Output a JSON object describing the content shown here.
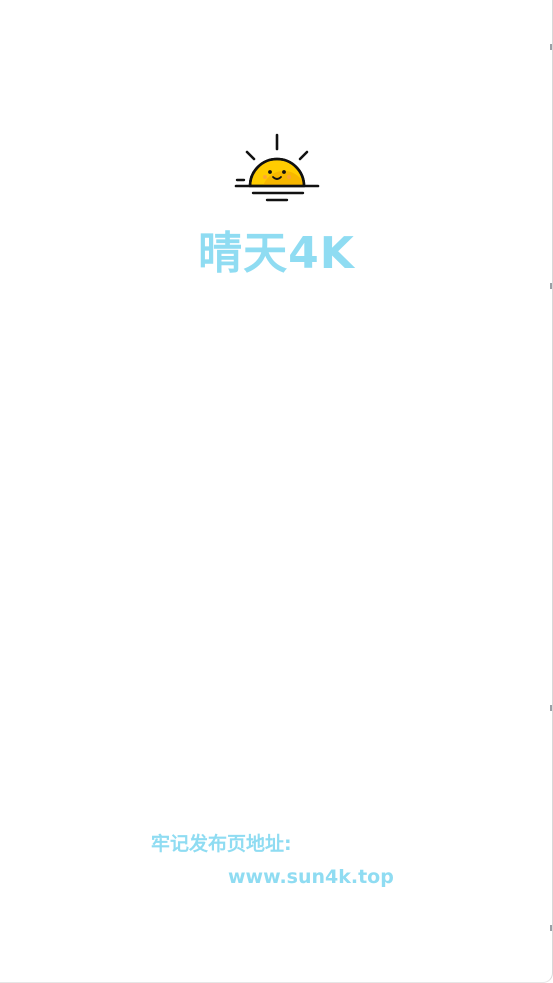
{
  "app": {
    "title": "晴天4K",
    "logo_icon": "sunrise-smiley-icon"
  },
  "footer": {
    "release_label": "牢记发布页地址:",
    "release_url": "www.sun4k.top"
  },
  "colors": {
    "accent": "#8fdcf2",
    "sun_fill": "#ffcc00",
    "sun_shadow": "#f0a500",
    "stroke": "#111111"
  }
}
